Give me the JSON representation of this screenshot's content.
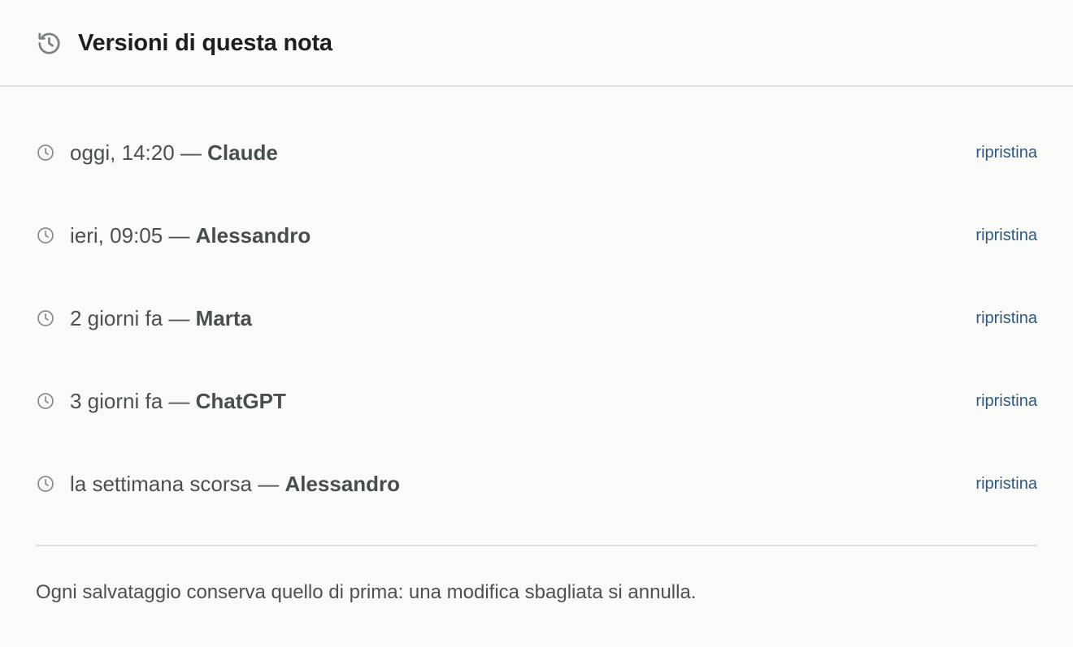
{
  "header": {
    "icon": "history-icon",
    "title": "Versioni di questa nota"
  },
  "versions": [
    {
      "when": "oggi, 14:20",
      "separator": " — ",
      "author": "Claude",
      "action": "ripristina"
    },
    {
      "when": "ieri, 09:05",
      "separator": " — ",
      "author": "Alessandro",
      "action": "ripristina"
    },
    {
      "when": "2 giorni fa",
      "separator": " — ",
      "author": "Marta",
      "action": "ripristina"
    },
    {
      "when": "3 giorni fa",
      "separator": " — ",
      "author": "ChatGPT",
      "action": "ripristina"
    },
    {
      "when": "la settimana scorsa",
      "separator": " — ",
      "author": "Alessandro",
      "action": "ripristina"
    }
  ],
  "footer": {
    "note": "Ogni salvataggio conserva quello di prima: una modifica sbagliata si annulla."
  },
  "colors": {
    "background": "#fafaf8",
    "title": "#1d1f1e",
    "text": "#4a524d",
    "link": "#2b5a86",
    "icon": "#8a908c"
  }
}
